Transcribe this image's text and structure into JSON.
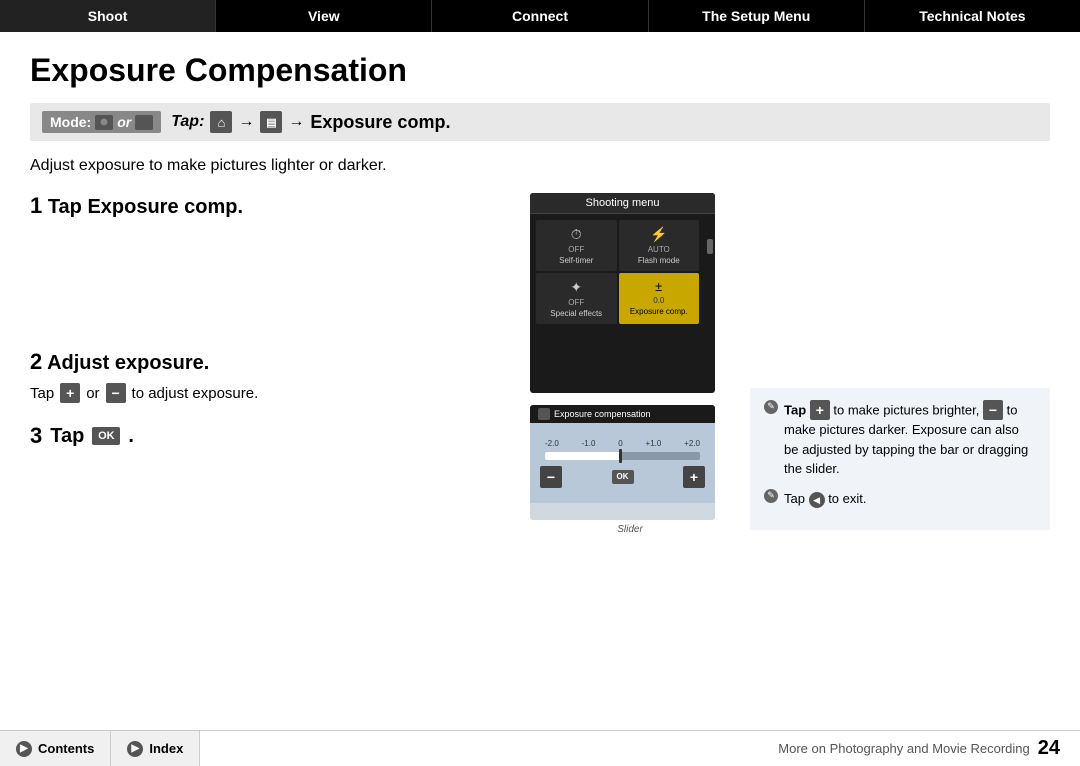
{
  "nav": {
    "items": [
      {
        "label": "Shoot",
        "active": true
      },
      {
        "label": "View",
        "active": false
      },
      {
        "label": "Connect",
        "active": false
      },
      {
        "label": "The Setup Menu",
        "active": false
      },
      {
        "label": "Technical Notes",
        "active": false
      }
    ]
  },
  "page": {
    "title": "Exposure Compensation",
    "mode_label": "Mode:",
    "mode_or": "or",
    "tap_label": "Tap:",
    "arrow": "→",
    "exposure_comp": "Exposure comp.",
    "description": "Adjust exposure to make pictures lighter or darker.",
    "step1_num": "1",
    "step1_title": "Tap Exposure comp.",
    "step2_num": "2",
    "step2_title": "Adjust exposure.",
    "step2_sub": "to adjust exposure.",
    "step2_tap": "Tap",
    "step2_or": "or",
    "step3_num": "3",
    "step3_title": "Tap",
    "shooting_menu_title": "Shooting menu",
    "menu_items": [
      {
        "icon": "⏱",
        "label": "Self-timer",
        "sublabel": "OFF",
        "selected": false
      },
      {
        "icon": "⚡",
        "label": "Flash mode",
        "sublabel": "AUTO",
        "selected": false
      },
      {
        "icon": "✦",
        "label": "Special effects",
        "sublabel": "OFF",
        "selected": false
      },
      {
        "icon": "±",
        "label": "Exposure comp.",
        "sublabel": "0.0",
        "selected": true
      }
    ],
    "exp_comp_header": "Exposure compensation",
    "slider_labels": [
      "-2.0",
      "-1.0",
      "0",
      "+1.0",
      "+2.0"
    ],
    "slider_label_caption": "Slider",
    "note1": "Tap   to make pictures brighter,   to make pictures darker. Exposure can also be adjusted by tapping the bar or dragging the slider.",
    "note2": "Tap   to exit.",
    "bottom_contents": "Contents",
    "bottom_index": "Index",
    "bottom_note": "More on Photography and Movie Recording",
    "page_number": "24"
  }
}
